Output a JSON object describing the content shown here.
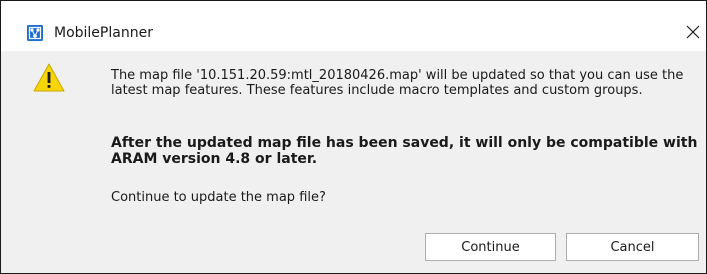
{
  "window": {
    "title": "MobilePlanner",
    "app_icon": "mobileplanner-app-icon",
    "close_icon": "close-icon"
  },
  "dialog": {
    "icon": "warning-icon",
    "message": "The map file '10.151.20.59:mtl_20180426.map' will be updated so that you can use the latest map features. These features include macro templates and custom groups.",
    "warning": "After the updated map file has been saved, it will only be compatible with ARAM version 4.8 or later.",
    "question": "Continue to update the map file?"
  },
  "buttons": {
    "continue_label": "Continue",
    "cancel_label": "Cancel"
  },
  "colors": {
    "warning_yellow": "#f6d60a",
    "app_icon_blue": "#1e6fd0",
    "dialog_bg": "#f0f0f0"
  }
}
